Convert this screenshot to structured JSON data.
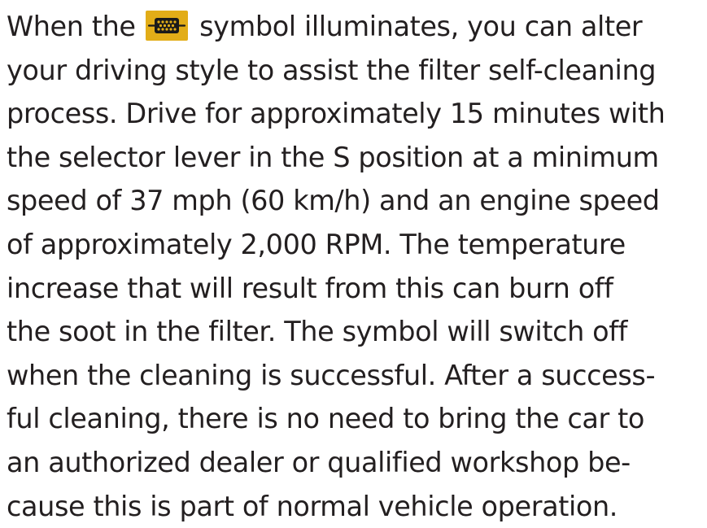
{
  "paragraph": {
    "lines": [
      {
        "before": "When the",
        "after": "symbol illuminates, you can alter"
      },
      "your driving style to assist the filter self-cleaning",
      "process. Drive for approximately 15 minutes with",
      "the selector lever in the S position at a minimum",
      "speed of 37 mph (60 km/h) and an engine speed",
      "of approximately 2,000 RPM. The temperature",
      "increase that will result from this can burn off",
      "the soot in the filter. The symbol will switch off",
      "when the cleaning is successful. After a success-",
      "ful cleaning, there is no need to bring the car to",
      "an authorized dealer or qualified workshop be-",
      "cause this is part of normal vehicle operation."
    ]
  },
  "icon": {
    "name": "diesel-particulate-filter-icon",
    "background_color": "#e2ad18",
    "glyph_color": "#1a1a1a"
  }
}
